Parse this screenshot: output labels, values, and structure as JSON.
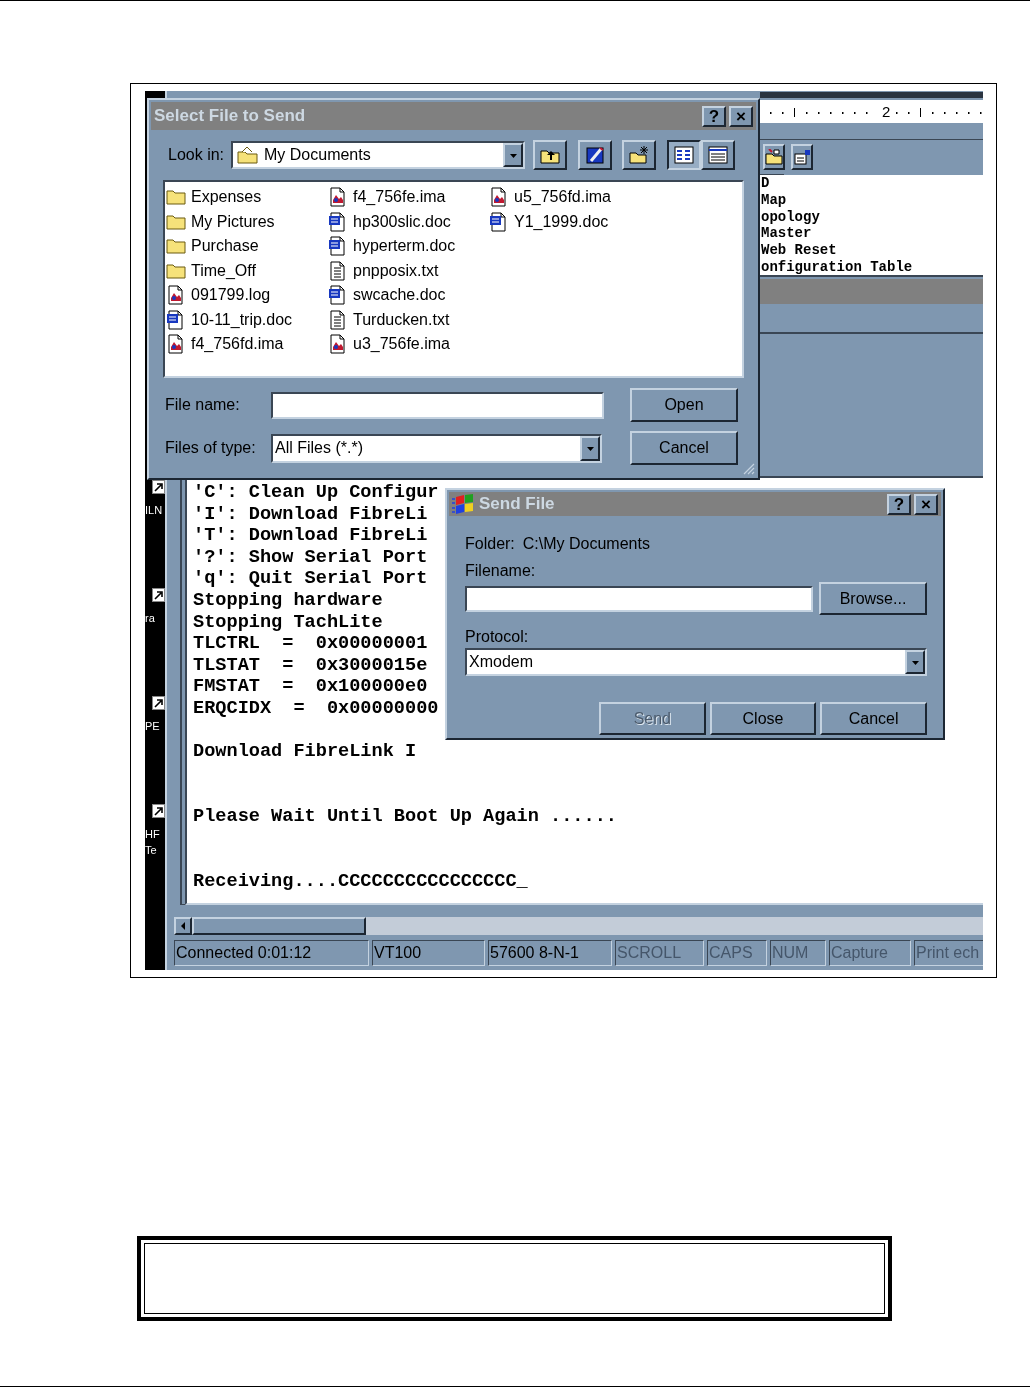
{
  "desktop": {
    "icons": [
      {
        "lines": [
          "ILN"
        ]
      },
      {
        "lines": [
          "ra"
        ]
      },
      {
        "lines": [
          "PE"
        ]
      },
      {
        "lines": [
          "HF",
          "Te"
        ]
      }
    ]
  },
  "terminal": {
    "lines": [
      {
        "kind": "text",
        "text": "'C': Clean Up Configur"
      },
      {
        "kind": "text",
        "text": "'I': Download FibreLi"
      },
      {
        "kind": "text",
        "text": "'T': Download FibreLi"
      },
      {
        "kind": "text",
        "text": "'?': Show Serial Port"
      },
      {
        "kind": "text",
        "text": "'q': Quit Serial Port"
      },
      {
        "kind": "text",
        "text": "Stopping hardware"
      },
      {
        "kind": "text",
        "text": "Stopping TachLite"
      },
      {
        "kind": "text",
        "text": "TLCTRL  =  0x00000001"
      },
      {
        "kind": "text",
        "text": "TLSTAT  =  0x3000015e"
      },
      {
        "kind": "text",
        "text": "FMSTAT  =  0x100000e0"
      },
      {
        "kind": "text",
        "text": "ERQCIDX  =  0x00000000"
      },
      {
        "kind": "blank"
      },
      {
        "kind": "text",
        "text": "Download FibreLink I"
      },
      {
        "kind": "blank"
      },
      {
        "kind": "blank"
      },
      {
        "kind": "text",
        "text": "Please Wait Until Boot Up Again ......"
      },
      {
        "kind": "blank"
      },
      {
        "kind": "blank"
      },
      {
        "kind": "text",
        "text": "Receiving....CCCCCCCCCCCCCCCC_"
      }
    ],
    "status_bar": [
      {
        "text": "Connected 0:01:12",
        "disabled": false
      },
      {
        "text": "VT100",
        "disabled": false
      },
      {
        "text": "57600 8-N-1",
        "disabled": false
      },
      {
        "text": "SCROLL",
        "disabled": true
      },
      {
        "text": "CAPS",
        "disabled": true
      },
      {
        "text": "NUM",
        "disabled": true
      },
      {
        "text": "Capture",
        "disabled": true
      },
      {
        "text": "Print ech",
        "disabled": true
      }
    ]
  },
  "side_window": {
    "ruler_label": "2",
    "lines": [
      "D",
      "Map",
      "opology",
      "Master",
      "Web Reset",
      "onfiguration Table"
    ]
  },
  "select_dialog": {
    "title": "Select File to Send",
    "title_buttons": [
      "?",
      "×"
    ],
    "look_in_label": "Look in:",
    "look_in_value": "My Documents",
    "view_buttons": [
      {
        "kind": "list",
        "selected": true
      },
      {
        "kind": "details",
        "selected": false
      }
    ],
    "files": [
      {
        "name": "Expenses",
        "kind": "folder"
      },
      {
        "name": "My Pictures",
        "kind": "folder"
      },
      {
        "name": "Purchase",
        "kind": "folder"
      },
      {
        "name": "Time_Off",
        "kind": "folder"
      },
      {
        "name": "091799.log",
        "kind": "image"
      },
      {
        "name": "10-11_trip.doc",
        "kind": "doc"
      },
      {
        "name": "f4_756fd.ima",
        "kind": "image"
      },
      {
        "name": "f4_756fe.ima",
        "kind": "image"
      },
      {
        "name": "hp300slic.doc",
        "kind": "doc"
      },
      {
        "name": "hyperterm.doc",
        "kind": "doc"
      },
      {
        "name": "pnpposix.txt",
        "kind": "text"
      },
      {
        "name": "swcache.doc",
        "kind": "doc"
      },
      {
        "name": "Turducken.txt",
        "kind": "text"
      },
      {
        "name": "u3_756fe.ima",
        "kind": "image"
      },
      {
        "name": "u5_756fd.ima",
        "kind": "image"
      },
      {
        "name": "Y1_1999.doc",
        "kind": "doc"
      }
    ],
    "file_name_label": "File name:",
    "files_of_type_label": "Files of type:",
    "files_of_type_value": "All Files (*.*)",
    "buttons": [
      "Open",
      "Cancel"
    ]
  },
  "send_dialog": {
    "title": "Send File",
    "title_buttons": [
      "?",
      "×"
    ],
    "folder_label": "Folder:",
    "folder_value": "C:\\My Documents",
    "filename_label": "Filename:",
    "browse_button": "Browse...",
    "protocol_label": "Protocol:",
    "protocol_value": "Xmodem",
    "buttons": [
      {
        "label": "Send",
        "disabled": true
      },
      {
        "label": "Close",
        "disabled": false
      },
      {
        "label": "Cancel",
        "disabled": false
      }
    ]
  }
}
